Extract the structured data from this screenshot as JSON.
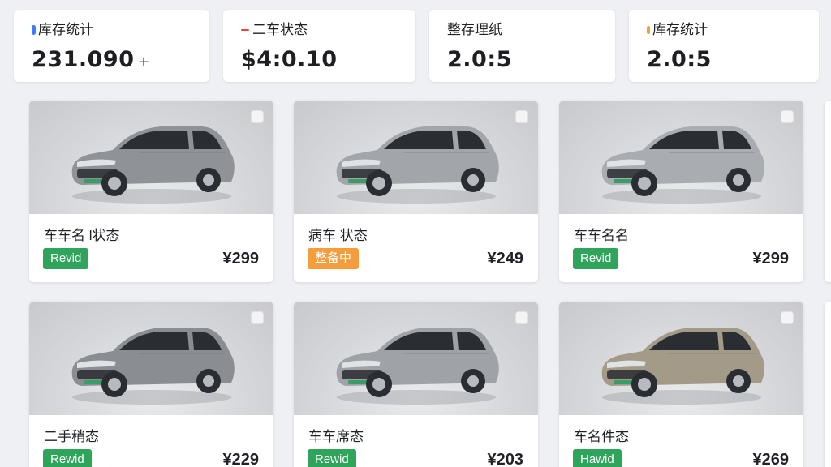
{
  "stats": [
    {
      "label": "库存统计",
      "value": "231.090",
      "suffix": "+",
      "mark_color": "#3d7bff",
      "mark": "pill"
    },
    {
      "label": "二车状态",
      "value": "$4:0.10",
      "suffix": "",
      "mark_color": "#e5483b",
      "mark": "dash"
    },
    {
      "label": "整存理纸",
      "value": "2.0:5",
      "suffix": "",
      "mark_color": "",
      "mark": "none"
    },
    {
      "label": "库存统计",
      "value": "2.0:5",
      "suffix": "",
      "mark_color": "#f0a23a",
      "mark": "pill"
    }
  ],
  "cards": [
    {
      "name": "车车名 l状态",
      "status": "Revid",
      "status_color": "#2ea55a",
      "price": "¥299",
      "car_color": "#8f9296"
    },
    {
      "name": "病车 状态",
      "status": "整备中",
      "status_color": "#f59c3c",
      "price": "¥249",
      "car_color": "#a2a6ab"
    },
    {
      "name": "车车名名",
      "status": "Revid",
      "status_color": "#2ea55a",
      "price": "¥299",
      "car_color": "#a9acb0"
    },
    {
      "name": "二手稍态",
      "status": "Rewid",
      "status_color": "#2ea55a",
      "price": "¥229",
      "car_color": "#8a8d92"
    },
    {
      "name": "车车席态",
      "status": "Rewid",
      "status_color": "#2ea55a",
      "price": "¥203",
      "car_color": "#9fa3a8"
    },
    {
      "name": "车名件态",
      "status": "Hawid",
      "status_color": "#2ea55a",
      "price": "¥269",
      "car_color": "#a39a88"
    }
  ]
}
